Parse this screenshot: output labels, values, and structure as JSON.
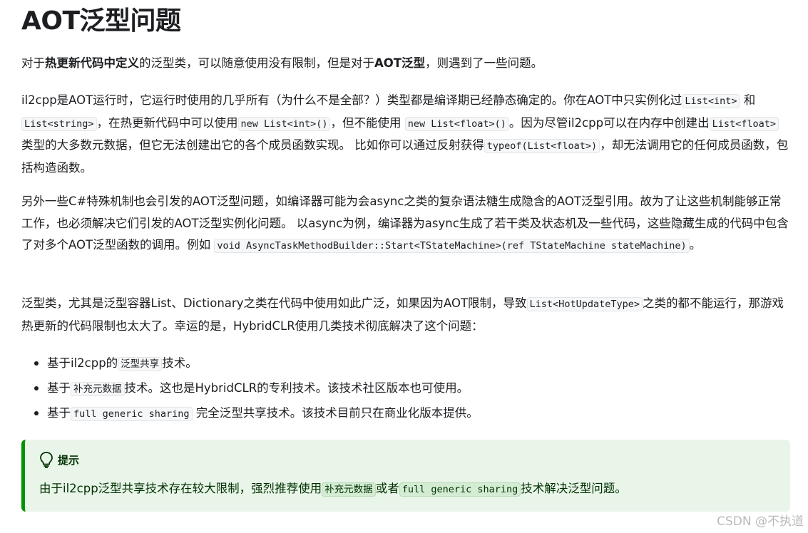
{
  "title": "AOT泛型问题",
  "p1": {
    "t1": "对于",
    "b1": "热更新代码中定义",
    "t2": "的泛型类，可以随意使用没有限制，但是对于",
    "b2": "AOT泛型",
    "t3": "，则遇到了一些问题。"
  },
  "p2": {
    "t1": "il2cpp是AOT运行时，它运行时使用的几乎所有（为什么不是全部？）类型都是编译期已经静态确定的。你在AOT中只实例化过",
    "c1": "List<int>",
    "t2": " 和 ",
    "c2": "List<string>",
    "t3": "，在热更新代码中可以使用",
    "c3": "new List<int>()",
    "t4": "，但不能使用 ",
    "c4": "new List<float>()",
    "t5": "。因为尽管il2cpp可以在内存中创建出",
    "c5": "List<float>",
    "t6": "类型的大多数元数据，但它无法创建出它的各个成员函数实现。 比如你可以通过反射获得",
    "c6": "typeof(List<float>)",
    "t7": "，却无法调用它的任何成员函数，包括构造函数。"
  },
  "p3": {
    "t1": "另外一些C#特殊机制也会引发的AOT泛型问题，如编译器可能为会async之类的复杂语法糖生成隐含的AOT泛型引用。故为了让这些机制能够正常工作，也必须解决它们引发的AOT泛型实例化问题。 以async为例，编译器为async生成了若干类及状态机及一些代码，这些隐藏生成的代码中包含了对多个AOT泛型函数的调用。例如 ",
    "c1": "void AsyncTaskMethodBuilder::Start<TStateMachine>(ref TStateMachine stateMachine)",
    "t2": "。"
  },
  "p4": {
    "t1": "泛型类，尤其是泛型容器List、Dictionary之类在代码中使用如此广泛，如果因为AOT限制，导致",
    "c1": "List<HotUpdateType>",
    "t2": "之类的都不能运行，那游戏热更新的代码限制也太大了。幸运的是，HybridCLR使用几类技术彻底解决了这个问题："
  },
  "list": [
    {
      "pre": "基于il2cpp的",
      "code": "泛型共享",
      "post": "技术。"
    },
    {
      "pre": "基于",
      "code": "补充元数据",
      "post": "技术。这也是HybridCLR的专利技术。该技术社区版本也可使用。"
    },
    {
      "pre": "基于",
      "code": "full generic sharing",
      "post": " 完全泛型共享技术。该技术目前只在商业化版本提供。"
    }
  ],
  "tip": {
    "icon": "lightbulb-icon",
    "label": "提示",
    "t1": "由于il2cpp泛型共享技术存在较大限制，强烈推荐使用",
    "c1": "补充元数据",
    "t2": "或者",
    "c2": "full generic sharing",
    "t3": "技术解决泛型问题。",
    "accent": "#009400",
    "background": "#e9f5e9"
  },
  "watermark": "CSDN @不执道"
}
